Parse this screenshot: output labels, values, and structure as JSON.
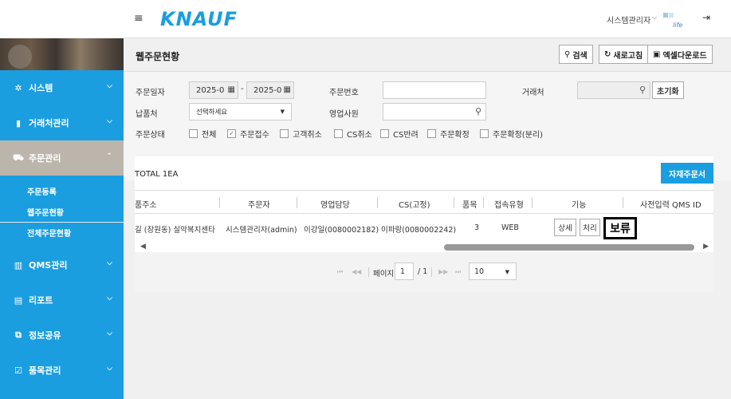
{
  "header": {
    "brand": "KNAUF",
    "user_name": "시스템관리자",
    "user_chevron": "⌵"
  },
  "sidebar": {
    "items": [
      {
        "label": "시스템",
        "icon": "gear-icon"
      },
      {
        "label": "거래처관리",
        "icon": "bookmark-icon"
      },
      {
        "label": "주문관리",
        "icon": "cart-icon"
      },
      {
        "label": "QMS관리",
        "icon": "columns-icon"
      },
      {
        "label": "리포트",
        "icon": "file-icon"
      },
      {
        "label": "정보공유",
        "icon": "share-icon"
      },
      {
        "label": "품목관리",
        "icon": "checkbox-icon"
      }
    ],
    "submenu": [
      "주문등록",
      "웹주문현황",
      "전체주문현황"
    ]
  },
  "page": {
    "title": "웹주문현황",
    "buttons": {
      "search": "검색",
      "refresh": "새로고침",
      "excel": "엑셀다운로드"
    }
  },
  "filters": {
    "order_date_label": "주문일자",
    "date_from": "2025-0",
    "date_to": "2025-0",
    "date_sep": "-",
    "order_no_label": "주문번호",
    "order_no_value": "",
    "client_label": "거래처",
    "client_value": "",
    "reset": "초기화",
    "delivery_label": "납품처",
    "delivery_value": "선택하세요",
    "sales_label": "영업사원",
    "sales_value": "",
    "status_label": "주문상태",
    "statuses": [
      {
        "label": "전체",
        "checked": false
      },
      {
        "label": "주문접수",
        "checked": true
      },
      {
        "label": "고객취소",
        "checked": false
      },
      {
        "label": "CS취소",
        "checked": false
      },
      {
        "label": "CS반려",
        "checked": false
      },
      {
        "label": "주문확정",
        "checked": false
      },
      {
        "label": "주문확정(분리)",
        "checked": false
      }
    ]
  },
  "list": {
    "total": "TOTAL 1EA",
    "export_button": "자재주문서",
    "columns": [
      "품주소",
      "주문자",
      "영업담당",
      "CS(고정)",
      "품목",
      "접속유형",
      "기능",
      "사전입력 QMS ID"
    ],
    "row": {
      "address": "길 (장원동) 실악복지센타",
      "orderer": "시스템관리자(admin)",
      "sales": "이강일(0080002182)",
      "cs": "이파랑(0080002242)",
      "items": "3",
      "channel": "WEB",
      "detail": "상세",
      "process": "처리",
      "hold": "보류"
    }
  },
  "pager": {
    "page_label": "페이지",
    "page_value": "1",
    "page_total": "/ 1",
    "page_size": "10"
  },
  "colors": {
    "sidebar": "#1a9ee0",
    "active_menu": "#bcb5ab",
    "brand": "#1a9ee0"
  }
}
